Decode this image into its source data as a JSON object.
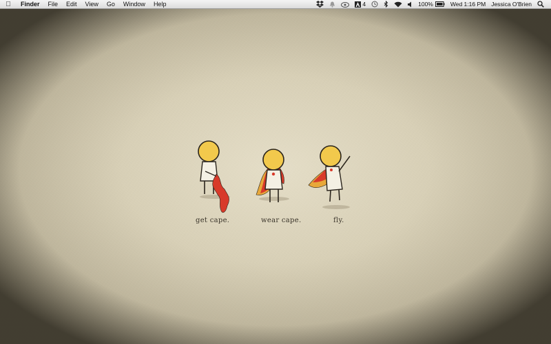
{
  "menubar": {
    "apple_icon": "",
    "items": [
      "Finder",
      "File",
      "Edit",
      "View",
      "Go",
      "Window",
      "Help"
    ],
    "status": {
      "adobe_count": "4",
      "battery": "100%",
      "clock": "Wed 1:16 PM",
      "user": "Jessica O'Brien"
    },
    "status_icons": [
      "dropbox-icon",
      "notification-icon",
      "cloud-icon",
      "adobe-icon",
      "time-machine-icon",
      "bluetooth-icon",
      "wifi-icon",
      "volume-icon",
      "battery-icon",
      "spotlight-icon"
    ]
  },
  "wallpaper": {
    "captions": [
      "get cape.",
      "wear cape.",
      "fly."
    ],
    "colors": {
      "background": "#d7cfb6",
      "head": "#f2c94c",
      "cape": "#d83a2a",
      "cape_inner": "#e8a83a",
      "ink": "#2a241c"
    }
  }
}
